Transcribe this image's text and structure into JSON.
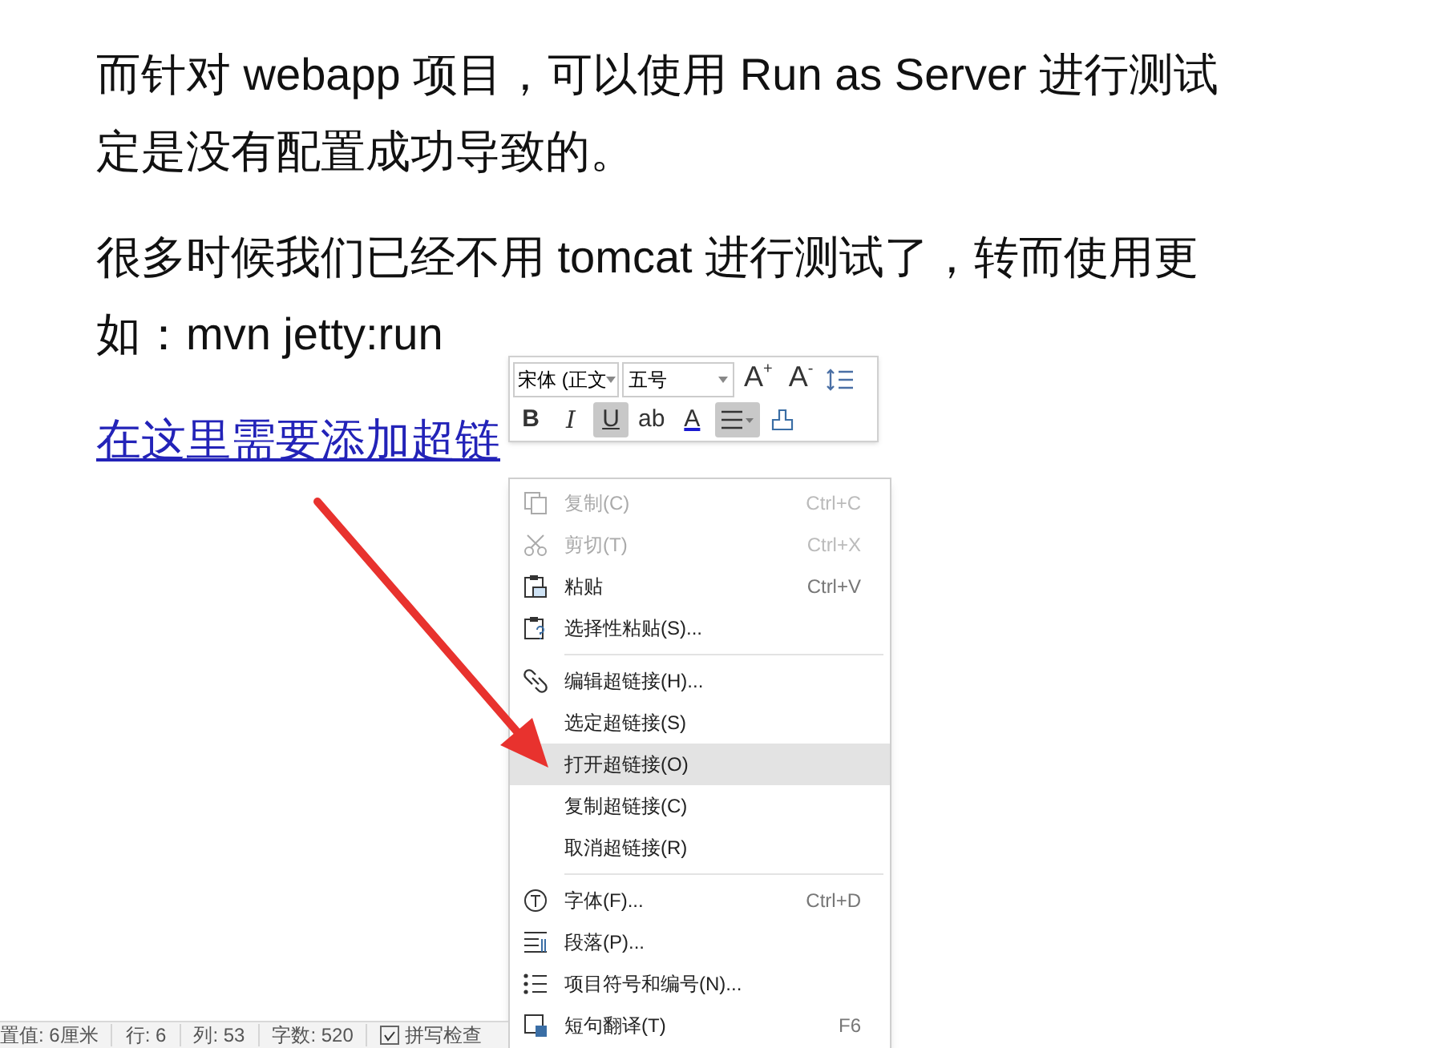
{
  "document": {
    "paragraphs": [
      {
        "kind": "text",
        "lines": [
          {
            "text": "而针对 webapp 项目，可以使用 Run as Server 进行测试"
          },
          {
            "text": "定是没有配置成功导致的。"
          }
        ]
      },
      {
        "kind": "text",
        "lines": [
          {
            "text": "很多时候我们已经不用 tomcat 进行测试了，转而使用更"
          },
          {
            "text": "如：mvn jetty:run"
          }
        ]
      },
      {
        "kind": "link",
        "lines": [
          {
            "text": "在这里需要添加超链"
          }
        ]
      }
    ]
  },
  "mini_toolbar": {
    "font_name": "宋体 (正文",
    "font_size": "五号",
    "grow_font": {
      "label": "A",
      "mark": "+"
    },
    "shrink_font": {
      "label": "A",
      "mark": "-"
    },
    "buttons": [
      {
        "kind": "bold",
        "label": "B",
        "pressed": false
      },
      {
        "kind": "italic",
        "label": "I",
        "pressed": false
      },
      {
        "kind": "underline",
        "label": "U",
        "pressed": true
      },
      {
        "kind": "highlight",
        "label": "ab",
        "pressed": false
      },
      {
        "kind": "color",
        "label": "A",
        "pressed": false
      },
      {
        "kind": "align",
        "pressed": true
      },
      {
        "kind": "painter",
        "pressed": false
      }
    ]
  },
  "context_menu": {
    "items": [
      {
        "kind": "item",
        "label": "复制(C)",
        "shortcut": "Ctrl+C",
        "disabled": true,
        "selected": false
      },
      {
        "kind": "item",
        "label": "剪切(T)",
        "shortcut": "Ctrl+X",
        "disabled": true,
        "selected": false
      },
      {
        "kind": "item",
        "label": "粘贴",
        "shortcut": "Ctrl+V",
        "disabled": false,
        "selected": false
      },
      {
        "kind": "item",
        "label": "选择性粘贴(S)...",
        "disabled": false,
        "selected": false
      },
      {
        "kind": "separator"
      },
      {
        "kind": "item",
        "label": "编辑超链接(H)...",
        "disabled": false,
        "selected": false
      },
      {
        "kind": "item",
        "label": "选定超链接(S)",
        "disabled": false,
        "selected": false
      },
      {
        "kind": "item",
        "label": "打开超链接(O)",
        "disabled": false,
        "selected": true
      },
      {
        "kind": "item",
        "label": "复制超链接(C)",
        "disabled": false,
        "selected": false
      },
      {
        "kind": "item",
        "label": "取消超链接(R)",
        "disabled": false,
        "selected": false
      },
      {
        "kind": "separator"
      },
      {
        "kind": "item",
        "label": "字体(F)...",
        "shortcut": "Ctrl+D",
        "disabled": false,
        "selected": false
      },
      {
        "kind": "item",
        "label": "段落(P)...",
        "disabled": false,
        "selected": false
      },
      {
        "kind": "item",
        "label": "项目符号和编号(N)...",
        "disabled": false,
        "selected": false
      },
      {
        "kind": "item",
        "label": "短句翻译(T)",
        "shortcut": "F6",
        "disabled": false,
        "selected": false
      }
    ]
  },
  "status_bar": {
    "items": [
      {
        "kind": "text",
        "label": "置值: 6厘米"
      },
      {
        "kind": "text",
        "label": "行: 6"
      },
      {
        "kind": "text",
        "label": "列: 53"
      },
      {
        "kind": "text",
        "label": "字数: 520"
      },
      {
        "kind": "checkbox",
        "label": "拼写检查",
        "checked": true
      }
    ]
  }
}
